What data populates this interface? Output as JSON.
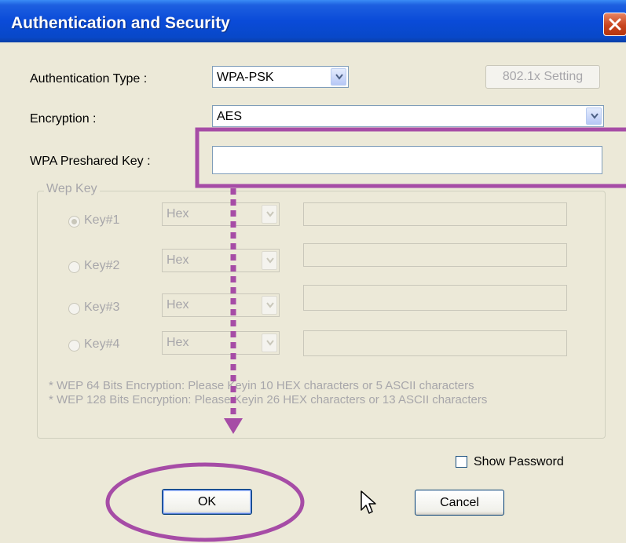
{
  "window": {
    "title": "Authentication and Security"
  },
  "auth_type": {
    "label": "Authentication Type :",
    "value": "WPA-PSK",
    "button": "802.1x Setting"
  },
  "encryption": {
    "label": "Encryption :",
    "value": "AES"
  },
  "wpa_key": {
    "label": "WPA Preshared Key :",
    "value": ""
  },
  "wep": {
    "group_label": "Wep Key",
    "keys": [
      {
        "label": "Key#1",
        "format": "Hex",
        "value": "",
        "selected": true
      },
      {
        "label": "Key#2",
        "format": "Hex",
        "value": "",
        "selected": false
      },
      {
        "label": "Key#3",
        "format": "Hex",
        "value": "",
        "selected": false
      },
      {
        "label": "Key#4",
        "format": "Hex",
        "value": "",
        "selected": false
      }
    ],
    "note_64": "* WEP 64 Bits Encryption:  Please Keyin 10 HEX characters or 5 ASCII characters",
    "note_128": "* WEP 128 Bits Encryption:  Please Keyin 26 HEX characters or 13 ASCII characters"
  },
  "show_password": {
    "label": "Show Password",
    "checked": false
  },
  "buttons": {
    "ok": "OK",
    "cancel": "Cancel"
  },
  "colors": {
    "titlebar": "#0a4bd8",
    "annotation": "#a64ca6",
    "window_bg": "#ece9d8",
    "close": "#c8441e"
  },
  "icons": [
    "close-icon",
    "chevron-down-icon",
    "cursor-arrow-icon",
    "dotted-arrow-annotation"
  ]
}
